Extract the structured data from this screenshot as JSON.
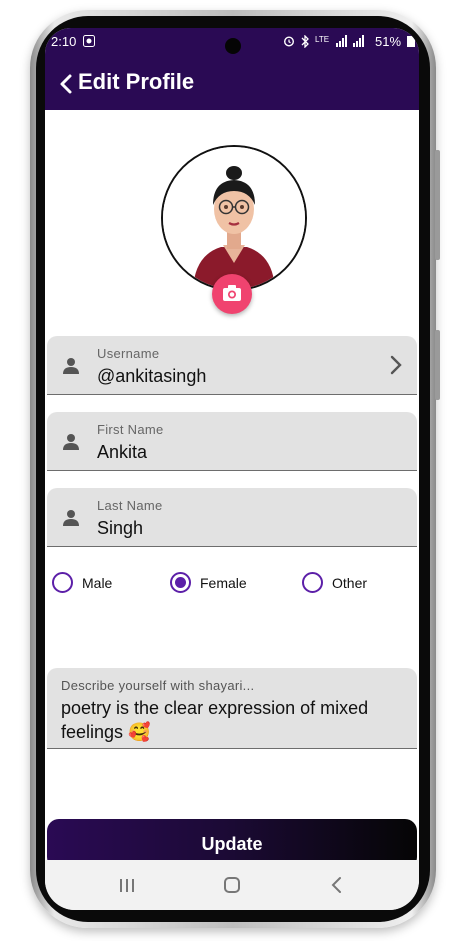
{
  "status_bar": {
    "time": "2:10",
    "battery": "51%",
    "network_label": "LTE"
  },
  "app_bar": {
    "title": "Edit Profile"
  },
  "profile": {
    "fields": [
      {
        "label": "Username",
        "value": "@ankitasingh"
      },
      {
        "label": "First Name",
        "value": "Ankita"
      },
      {
        "label": "Last Name",
        "value": "Singh"
      }
    ],
    "gender_options": [
      {
        "label": "Male",
        "selected": false
      },
      {
        "label": "Female",
        "selected": true
      },
      {
        "label": "Other",
        "selected": false
      }
    ],
    "bio": {
      "placeholder": "Describe yourself with shayari...",
      "value": "poetry is the clear expression of mixed feelings 🥰"
    }
  },
  "actions": {
    "update_label": "Update"
  },
  "colors": {
    "app_bar": "#2a0a54",
    "accent": "#5c1fa8",
    "camera_button": "#f0436f",
    "field_bg": "#e2e2e2"
  },
  "icons": [
    "back-arrow",
    "person",
    "chevron-right",
    "camera",
    "recents",
    "home",
    "back"
  ]
}
